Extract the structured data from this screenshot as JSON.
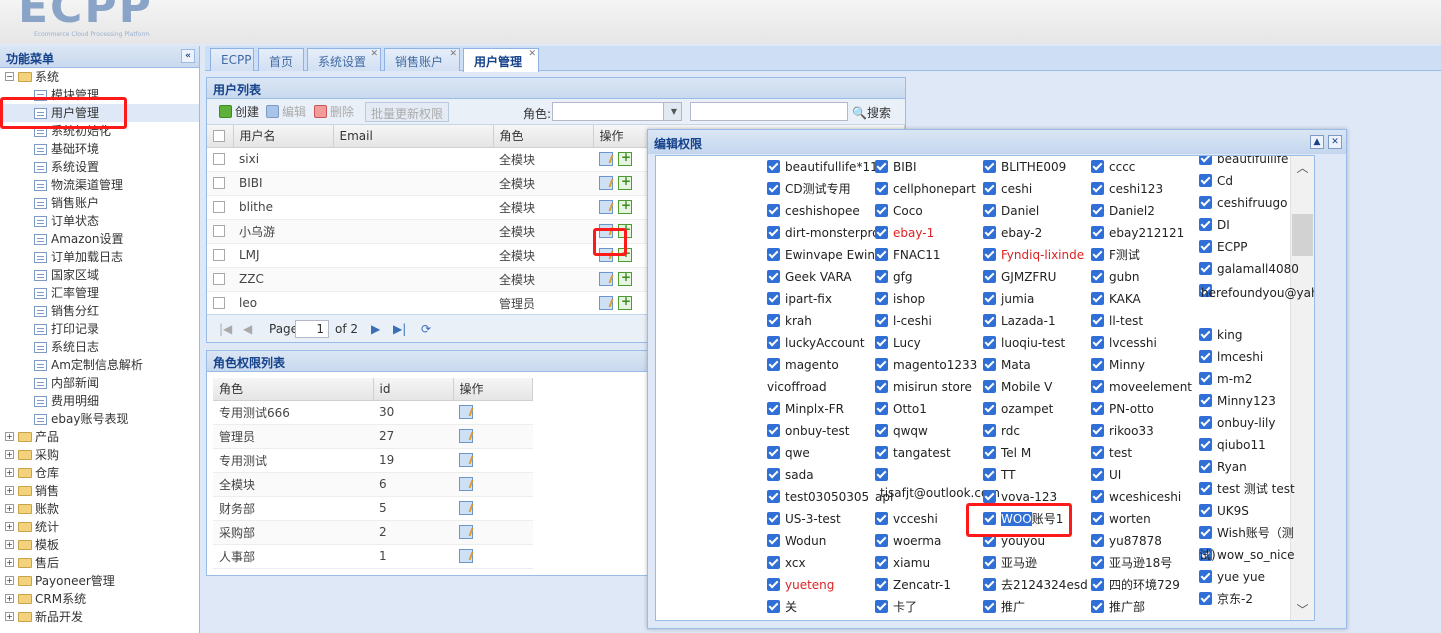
{
  "app": {
    "logo": "ECPP",
    "logo_sub": "Ecommerce Cloud Processing Platform"
  },
  "sidebar": {
    "title": "功能菜单",
    "collapse": "«",
    "nodes": [
      {
        "label": "系统",
        "type": "folder",
        "expanded": true
      },
      {
        "label": "模块管理",
        "type": "leaf"
      },
      {
        "label": "用户管理",
        "type": "leaf",
        "selected": true
      },
      {
        "label": "系统初始化",
        "type": "leaf"
      },
      {
        "label": "基础环境",
        "type": "leaf"
      },
      {
        "label": "系统设置",
        "type": "leaf"
      },
      {
        "label": "物流渠道管理",
        "type": "leaf"
      },
      {
        "label": "销售账户",
        "type": "leaf"
      },
      {
        "label": "订单状态",
        "type": "leaf"
      },
      {
        "label": "Amazon设置",
        "type": "leaf"
      },
      {
        "label": "订单加载日志",
        "type": "leaf"
      },
      {
        "label": "国家区域",
        "type": "leaf"
      },
      {
        "label": "汇率管理",
        "type": "leaf"
      },
      {
        "label": "销售分红",
        "type": "leaf"
      },
      {
        "label": "打印记录",
        "type": "leaf"
      },
      {
        "label": "系统日志",
        "type": "leaf"
      },
      {
        "label": "Am定制信息解析",
        "type": "leaf"
      },
      {
        "label": "内部新闻",
        "type": "leaf"
      },
      {
        "label": "费用明细",
        "type": "leaf"
      },
      {
        "label": "ebay账号表现",
        "type": "leaf"
      },
      {
        "label": "产品",
        "type": "folder"
      },
      {
        "label": "采购",
        "type": "folder"
      },
      {
        "label": "仓库",
        "type": "folder"
      },
      {
        "label": "销售",
        "type": "folder"
      },
      {
        "label": "账款",
        "type": "folder"
      },
      {
        "label": "统计",
        "type": "folder"
      },
      {
        "label": "模板",
        "type": "folder"
      },
      {
        "label": "售后",
        "type": "folder"
      },
      {
        "label": "Payoneer管理",
        "type": "folder"
      },
      {
        "label": "CRM系统",
        "type": "folder"
      },
      {
        "label": "新品开发",
        "type": "folder"
      }
    ]
  },
  "tabs": [
    {
      "label": "ECPP",
      "closable": false
    },
    {
      "label": "首页",
      "closable": false
    },
    {
      "label": "系统设置",
      "closable": true
    },
    {
      "label": "销售账户",
      "closable": true
    },
    {
      "label": "用户管理",
      "closable": true,
      "active": true
    }
  ],
  "user_panel": {
    "title": "用户列表",
    "toolbar": {
      "create": "创建",
      "edit": "编辑",
      "delete": "删除",
      "batch": "批量更新权限",
      "role_label": "角色:",
      "search": "搜索"
    },
    "columns": [
      "用户名",
      "Email",
      "角色",
      "操作"
    ],
    "rows": [
      {
        "name": "sixi",
        "email": "",
        "role": "全模块"
      },
      {
        "name": "BIBI",
        "email": "",
        "role": "全模块"
      },
      {
        "name": "blithe",
        "email": "",
        "role": "全模块"
      },
      {
        "name": "小乌游",
        "email": "",
        "role": "全模块"
      },
      {
        "name": "LMJ",
        "email": "",
        "role": "全模块"
      },
      {
        "name": "ZZC",
        "email": "",
        "role": "全模块"
      },
      {
        "name": "leo",
        "email": "",
        "role": "管理员"
      }
    ],
    "pager": {
      "page_label": "Page",
      "page": "1",
      "of": "of 2"
    }
  },
  "role_panel": {
    "title": "角色权限列表",
    "columns": [
      "角色",
      "id",
      "操作"
    ],
    "rows": [
      {
        "role": "专用测试666",
        "id": "30"
      },
      {
        "role": "管理员",
        "id": "27"
      },
      {
        "role": "专用测试",
        "id": "19"
      },
      {
        "role": "全模块",
        "id": "6"
      },
      {
        "role": "财务部",
        "id": "5"
      },
      {
        "role": "采购部",
        "id": "2"
      },
      {
        "role": "人事部",
        "id": "1"
      }
    ]
  },
  "dialog": {
    "title": "编辑权限",
    "tool_up": "▲",
    "tool_close": "✕",
    "scroll_up": "︿",
    "scroll_down": "﹀",
    "col1": [
      "beautifullife*11",
      "CD测试专用",
      "ceshishopee",
      "dirt-monsterpro",
      "Ewinvape Ewin",
      "Geek VARA",
      "ipart-fix",
      "krah",
      "luckyAccount",
      "magento",
      "Minplx-FR",
      "onbuy-test",
      "qwe",
      "sada",
      "test03050305",
      "US-3-test",
      "Wodun",
      "xcx",
      "yueteng",
      "关"
    ],
    "col1_cont": "vicoffroad",
    "col2": [
      "BIBI",
      "cellphonepart",
      "Coco",
      "ebay-1",
      "FNAC11",
      "gfg",
      "ishop",
      "l-ceshi",
      "Lucy",
      "magento1233",
      "misirun store",
      "Otto1",
      "qwqw",
      "tangatest",
      "",
      "vcceshi",
      "woerma",
      "xiamu",
      "Zencatr-1",
      "卡了"
    ],
    "col2_extra": "tisafjt@outlook.com",
    "col2_cont": "api",
    "col3": [
      "BLITHE009",
      "ceshi",
      "Daniel",
      "ebay-2",
      "Fyndiq-lixinde",
      "GJMZFRU",
      "jumia",
      "Lazada-1",
      "luoqiu-test",
      "Mata",
      "Mobile V",
      "ozampet",
      "rdc",
      "Tel M",
      "TT",
      "vova-123",
      "WOO账号1",
      "youyou",
      "亚马逊",
      "去2124324esd",
      "推广"
    ],
    "col3_hl": "WOO",
    "col3_rest": "账号1",
    "col4": [
      "cccc",
      "ceshi123",
      "Daniel2",
      "ebay212121",
      "F测试",
      "gubn",
      "KAKA",
      "ll-test",
      "lvcesshi",
      "Minny",
      "moveelement",
      "PN-otto",
      "rikoo33",
      "test",
      "UI",
      "wceshiceshi",
      "worten",
      "yu87878",
      "亚马逊18号",
      "四的环境729",
      "推广部"
    ],
    "col5": [
      "beautifullife",
      "Cd",
      "ceshifruugo",
      "DI",
      "ECPP",
      "galamall4080",
      "",
      "king",
      "lmceshi",
      "m-m2",
      "Minny123",
      "onbuy-lily",
      "qiubo11",
      "Ryan",
      "test 测试 test",
      "UK9S",
      "Wish账号（测",
      "wow_so_nice",
      "yue yue",
      "京东-2"
    ],
    "col5_extra": "herefoundyou@yah",
    "col5_cont": "试)",
    "red_items": [
      "ebay-1",
      "Fyndiq-lixinde",
      "yueteng"
    ]
  }
}
